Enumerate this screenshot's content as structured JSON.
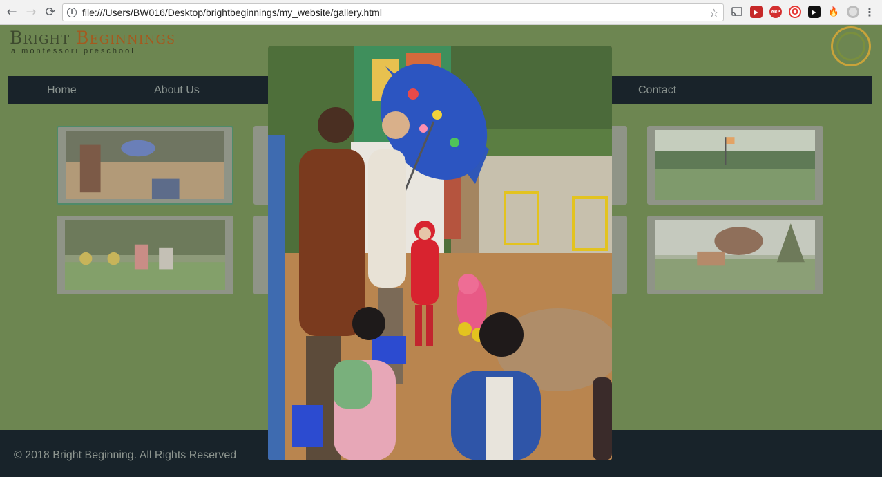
{
  "browser": {
    "url": "file:///Users/BW016/Desktop/brightbeginnings/my_website/gallery.html",
    "back_icon": "←",
    "forward_icon": "→",
    "reload_icon": "⟳",
    "star_icon": "☆",
    "info_icon": "i",
    "extensions": [
      {
        "name": "cast-icon",
        "label": "",
        "color": "#5f6368"
      },
      {
        "name": "adblock-video-icon",
        "label": "▶",
        "color": "#c62828"
      },
      {
        "name": "abp-icon",
        "label": "ABP",
        "color": "#d32f2f"
      },
      {
        "name": "opera-icon",
        "label": "O",
        "color": "#e53935"
      },
      {
        "name": "youtube-icon",
        "label": "▶",
        "color": "#111111"
      },
      {
        "name": "fire-icon",
        "label": "🔥",
        "color": "#f57c00"
      },
      {
        "name": "circle-ext-icon",
        "label": "",
        "color": "#bdbdbd"
      },
      {
        "name": "menu-icon",
        "label": "⋮",
        "color": "#5f6368"
      }
    ]
  },
  "site": {
    "logo": {
      "first": "Bright",
      "second": "Beginnings",
      "tagline": "a montessori preschool"
    },
    "nav": [
      {
        "label": "Home"
      },
      {
        "label": "About Us"
      },
      {
        "label": "Contact"
      }
    ],
    "footer": "© 2018 Bright Beginning. All Rights Reserved"
  },
  "gallery": {
    "thumbnails": [
      {
        "name": "gallery-thumb-1",
        "scene": "umbrella-courtyard"
      },
      {
        "name": "gallery-thumb-2",
        "scene": "hidden"
      },
      {
        "name": "gallery-thumb-3",
        "scene": "hidden"
      },
      {
        "name": "gallery-thumb-4",
        "scene": "field-flag"
      },
      {
        "name": "gallery-thumb-5",
        "scene": "playground"
      },
      {
        "name": "gallery-thumb-6",
        "scene": "hidden"
      },
      {
        "name": "gallery-thumb-7",
        "scene": "hidden"
      },
      {
        "name": "gallery-thumb-8",
        "scene": "garden-trees"
      }
    ],
    "modal": {
      "scene": "umbrella-courtyard"
    }
  },
  "colors": {
    "page_bg": "#6d8651",
    "nav_bg": "#19232a",
    "footer_bg": "#18232a"
  }
}
